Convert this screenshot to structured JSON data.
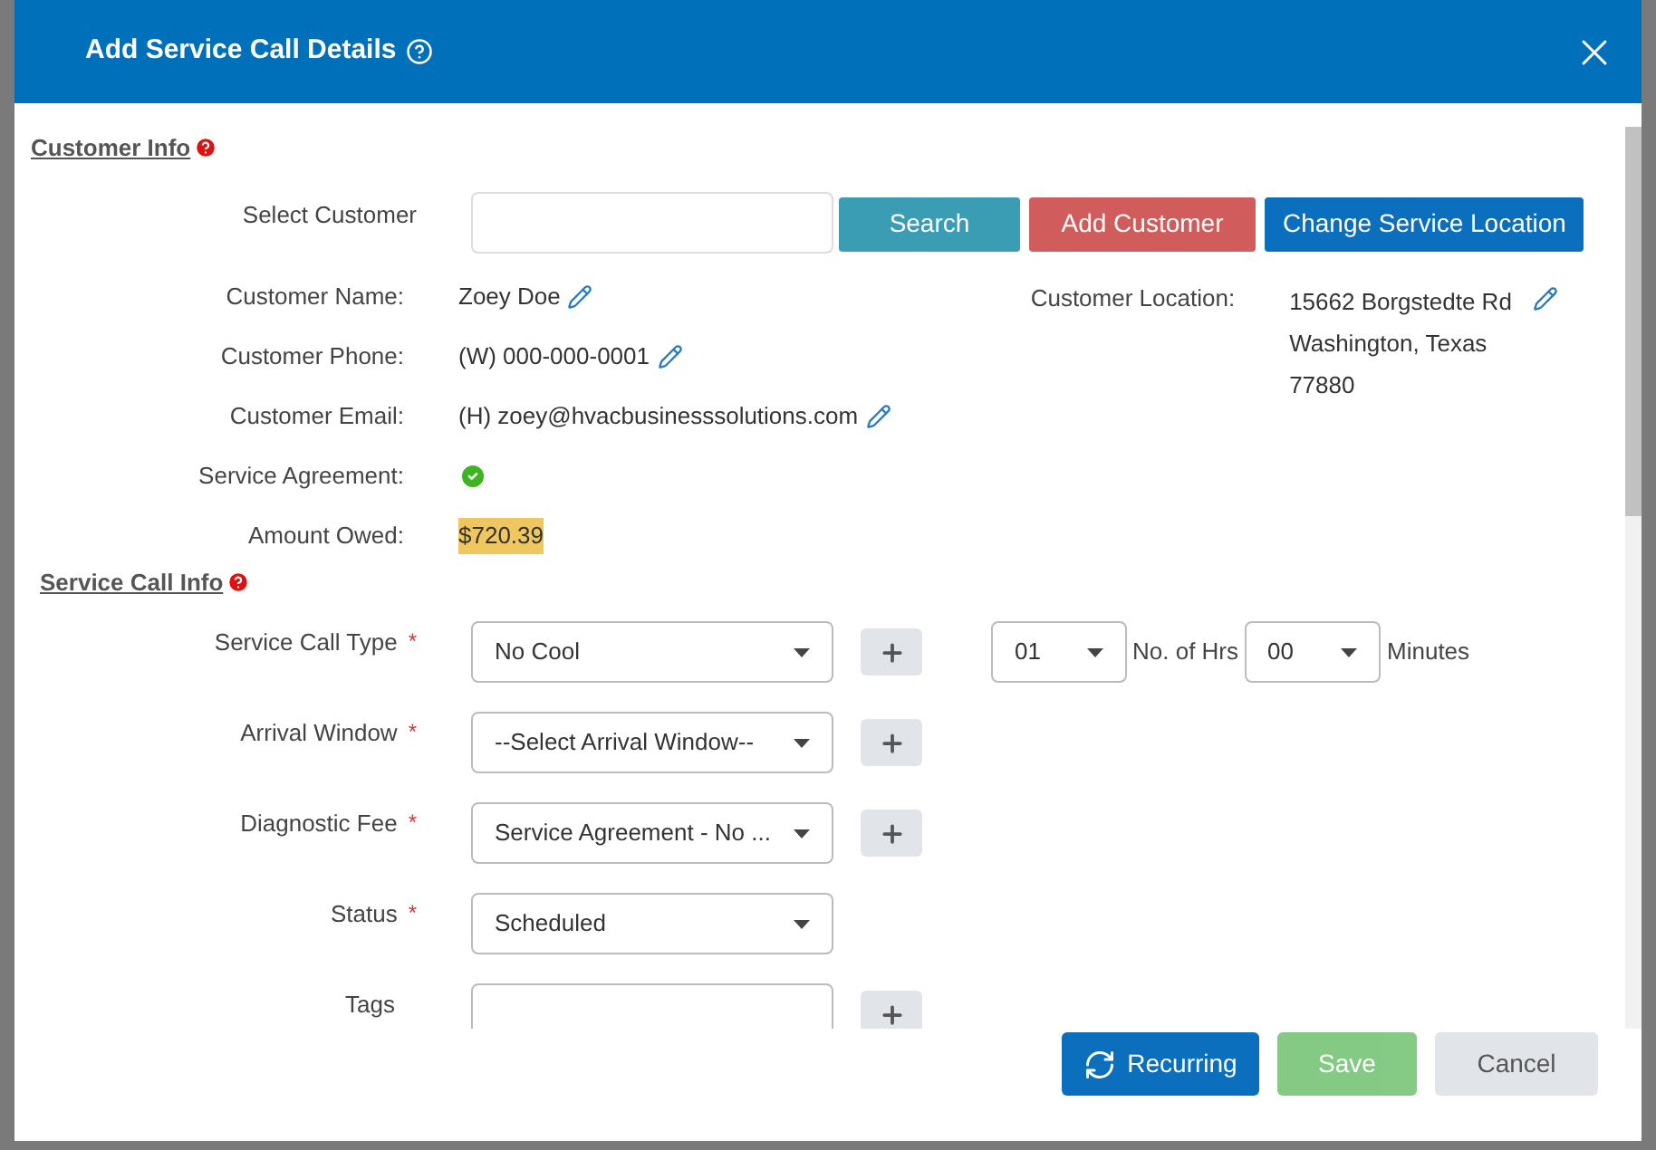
{
  "dialog": {
    "title": "Add Service Call Details"
  },
  "customer_info": {
    "heading": "Customer Info",
    "select_label": "Select Customer",
    "buttons": [
      {
        "label": "Search",
        "kind": "search"
      },
      {
        "label": "Add Customer",
        "kind": "add"
      },
      {
        "label": "Change Service Location",
        "kind": "location"
      }
    ],
    "fields": [
      {
        "label": "Customer Name:",
        "kind": "text",
        "value": "Zoey Doe",
        "editable": true
      },
      {
        "label": "Customer Phone:",
        "kind": "text",
        "value": "(W) 000-000-0001",
        "editable": true
      },
      {
        "label": "Customer Email:",
        "kind": "text",
        "value": "(H) zoey@hvacbusinesssolutions.com",
        "editable": true
      },
      {
        "label": "Service Agreement:",
        "kind": "check",
        "checked": true
      },
      {
        "label": "Amount Owed:",
        "kind": "money",
        "value": "$720.39"
      }
    ],
    "location": {
      "label": "Customer Location:",
      "lines": [
        "15662 Borgstedte Rd",
        "Washington, Texas",
        "77880"
      ],
      "editable": true
    }
  },
  "service_call_info": {
    "heading": "Service Call Info",
    "fields": [
      {
        "label": "Service Call Type",
        "required_mark": "*",
        "value": "No Cool",
        "addable": true
      },
      {
        "label": "Arrival Window",
        "required_mark": "*",
        "value": "--Select Arrival Window--",
        "addable": true
      },
      {
        "label": "Diagnostic Fee",
        "required_mark": "*",
        "value": "Service Agreement - No ...",
        "addable": true
      },
      {
        "label": "Status",
        "required_mark": "*",
        "value": "Scheduled",
        "addable": false
      },
      {
        "label": "Tags",
        "addable": true,
        "kind": "input"
      }
    ],
    "duration": {
      "hours": "01",
      "hours_label": "No. of Hrs",
      "minutes": "00",
      "minutes_label": "Minutes"
    }
  },
  "footer": [
    {
      "label": "Recurring",
      "kind": "recurring",
      "disabled": false
    },
    {
      "label": "Save",
      "kind": "save",
      "disabled": true
    },
    {
      "label": "Cancel",
      "kind": "cancel",
      "disabled": false
    }
  ]
}
